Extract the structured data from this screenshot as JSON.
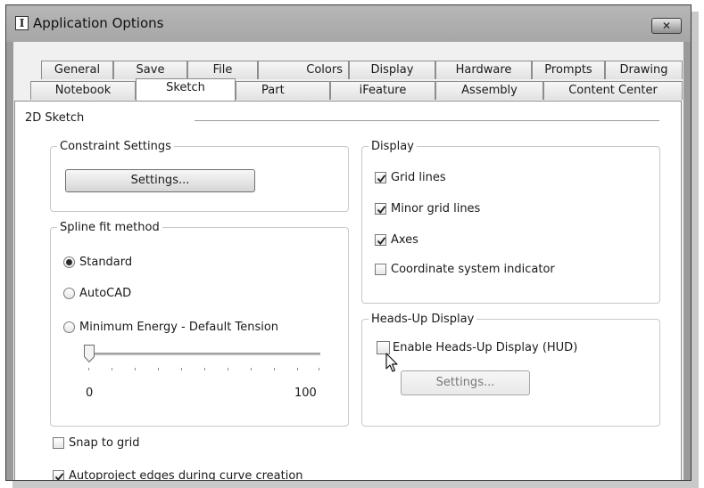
{
  "window": {
    "title": "Application Options",
    "icon_glyph": "I",
    "icon_name": "inventor-app-icon",
    "close_glyph": "✕"
  },
  "tabs_back": [
    "General",
    "Save",
    "File",
    "Colors",
    "Display",
    "Hardware",
    "Prompts",
    "Drawing"
  ],
  "tabs_front": [
    "Notebook",
    "Sketch",
    "Part",
    "iFeature",
    "Assembly",
    "Content Center"
  ],
  "active_tab": "Sketch",
  "page": {
    "heading": "2D Sketch",
    "constraint": {
      "legend": "Constraint Settings",
      "button": "Settings..."
    },
    "spline": {
      "legend": "Spline fit method",
      "options": [
        {
          "label": "Standard",
          "selected": true
        },
        {
          "label": "AutoCAD",
          "selected": false
        },
        {
          "label": "Minimum Energy - Default Tension",
          "selected": false
        }
      ],
      "slider_min": "0",
      "slider_max": "100",
      "slider_value": 0
    },
    "display": {
      "legend": "Display",
      "options": [
        {
          "label": "Grid lines",
          "checked": true
        },
        {
          "label": "Minor grid lines",
          "checked": true
        },
        {
          "label": "Axes",
          "checked": true
        },
        {
          "label": "Coordinate system indicator",
          "checked": false
        }
      ]
    },
    "hud": {
      "legend": "Heads-Up Display",
      "enable_label": "Enable Heads-Up Display (HUD)",
      "enable_checked": false,
      "button": "Settings...",
      "button_enabled": false
    },
    "snap_to_grid": {
      "label": "Snap to grid",
      "checked": false
    },
    "autoproject": {
      "label": "Autoproject edges during curve creation",
      "checked": true
    }
  }
}
